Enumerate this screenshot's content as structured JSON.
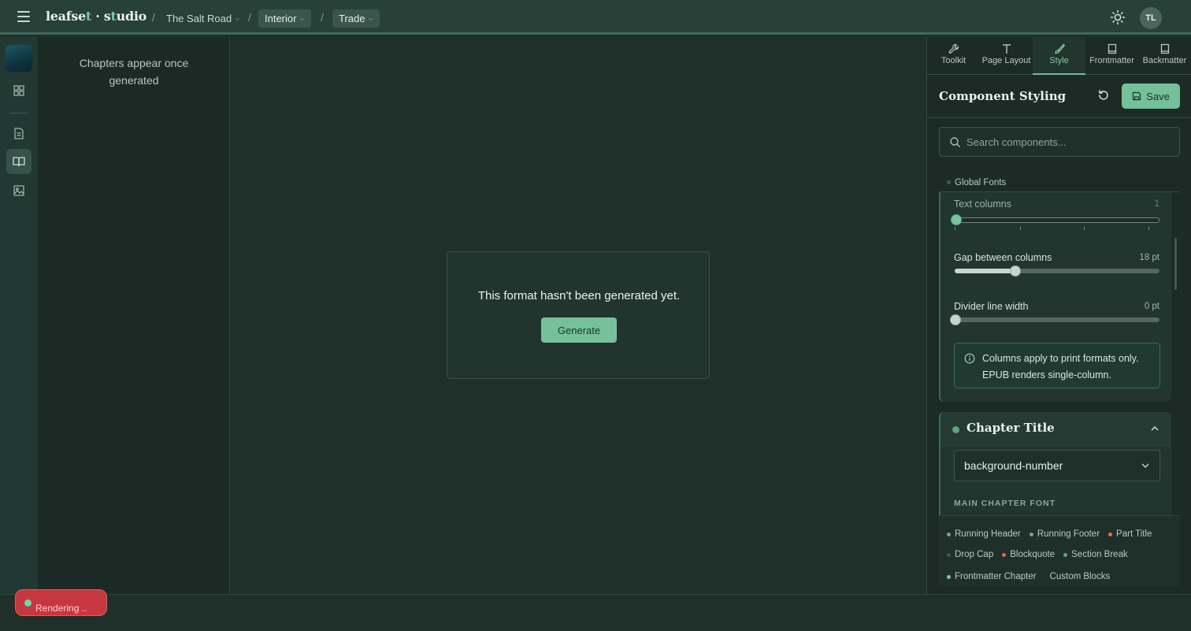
{
  "app": {
    "logo_main": "leafse",
    "logo_t": "t",
    "logo_dot": " · s",
    "logo_t2": "t",
    "logo_end": "udio"
  },
  "breadcrumb": {
    "project": "The Salt Road",
    "format": "Interior",
    "trim": "Trade"
  },
  "user": {
    "initials": "TL"
  },
  "chapters_pane": {
    "empty_text": "Chapters appear once generated"
  },
  "canvas": {
    "empty_message": "This format hasn't been generated yet.",
    "generate_label": "Generate"
  },
  "status": {
    "rendering_label": "Rendering .."
  },
  "panel": {
    "tabs": [
      {
        "label": "Toolkit",
        "icon": "wrench-icon"
      },
      {
        "label": "Page Layout",
        "icon": "type-icon"
      },
      {
        "label": "Style",
        "icon": "brush-icon",
        "active": true
      },
      {
        "label": "Frontmatter",
        "icon": "book-icon"
      },
      {
        "label": "Backmatter",
        "icon": "book-icon"
      }
    ],
    "title": "Component Styling",
    "save_label": "Save",
    "search_placeholder": "Search components...",
    "global_fonts": "Global Fonts",
    "columns_section": {
      "text_columns": {
        "label": "Text columns",
        "value": "1",
        "fraction": 0.0
      },
      "gap": {
        "label": "Gap between columns",
        "value": "18 pt",
        "fraction": 0.3
      },
      "divider": {
        "label": "Divider line width",
        "value": "0 pt",
        "fraction": 0.0
      },
      "info": "Columns apply to print formats only. EPUB renders single-column."
    },
    "chapter_title": {
      "label": "Chapter Title",
      "style_value": "background-number",
      "subhead": "MAIN CHAPTER FONT"
    },
    "components": [
      {
        "label": "Running Header",
        "color": "#8a9a93"
      },
      {
        "label": "Running Footer",
        "color": "#8a9a93"
      },
      {
        "label": "Part Title",
        "color": "#d07a3a"
      },
      {
        "label": "Drop Cap",
        "color": "#3b5a4e"
      },
      {
        "label": "Blockquote",
        "color": "#d07a3a"
      },
      {
        "label": "Section Break",
        "color": "#5da47f"
      },
      {
        "label": "Frontmatter Chapter",
        "color": "#7fc9a3"
      },
      {
        "label": "Custom Blocks",
        "color": ""
      }
    ]
  },
  "colors": {
    "accent": "#75c19a",
    "alert": "#c7373f",
    "background": "#1f2f29"
  }
}
